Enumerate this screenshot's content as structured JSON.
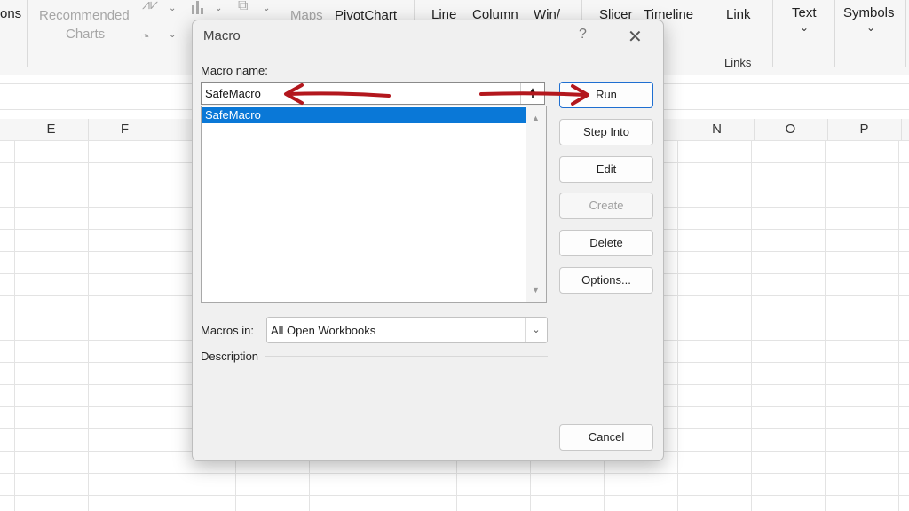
{
  "ribbon": {
    "tab_fragment": "ons",
    "recommended_charts_line1": "Recommended",
    "recommended_charts_line2": "Charts",
    "maps": "Maps",
    "pivotchart": "PivotChart",
    "line": "Line",
    "column": "Column",
    "winloss": "Win/",
    "slicer": "Slicer",
    "timeline": "Timeline",
    "link": "Link",
    "links_group": "Links",
    "text": "Text",
    "symbols": "Symbols"
  },
  "columns": [
    "E",
    "F",
    "N",
    "O",
    "P"
  ],
  "dialog": {
    "title": "Macro",
    "help": "?",
    "close": "✕",
    "macro_name_label": "Macro name:",
    "macro_name_value": "SafeMacro",
    "list_items": [
      "SafeMacro"
    ],
    "macros_in_label": "Macros in:",
    "macros_in_value": "All Open Workbooks",
    "description_label": "Description",
    "buttons": {
      "run": "Run",
      "step_into": "Step Into",
      "edit": "Edit",
      "create": "Create",
      "delete": "Delete",
      "options": "Options...",
      "cancel": "Cancel"
    }
  },
  "annotation_color": "#b3171d"
}
